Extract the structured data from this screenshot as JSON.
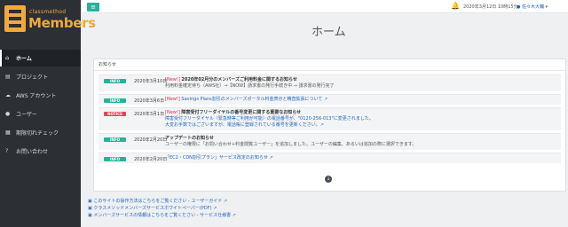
{
  "brand": {
    "small": "classmethod",
    "big": "Members"
  },
  "sidebar": {
    "items": [
      {
        "icon": "home-icon",
        "glyph": "⌂",
        "label": "ホーム"
      },
      {
        "icon": "document-icon",
        "glyph": "▤",
        "label": "プロジェクト"
      },
      {
        "icon": "cloud-icon",
        "glyph": "☁",
        "label": "AWS アカウント"
      },
      {
        "icon": "user-icon",
        "glyph": "●",
        "label": "ユーザー"
      },
      {
        "icon": "calendar-icon",
        "glyph": "▦",
        "label": "期限切れチェック"
      },
      {
        "icon": "question-icon",
        "glyph": "?",
        "label": "お問い合わせ"
      }
    ]
  },
  "topbar": {
    "menu_glyph": "≡",
    "bell_glyph": "🔔",
    "datetime": "2020年3月12日 10時15分",
    "user": "● 佐々木大輔 ▾"
  },
  "page_title": "ホーム",
  "notices": {
    "header": "お知らせ",
    "items": [
      {
        "badge": "INFO",
        "date": "2020年3月10日",
        "new": "[New!]",
        "title": "2020年02月分のメンバーズご利用料金に関するお知らせ",
        "line2": "利用料金確定待ち（AWS社）→【NOW】請求書の発行手続き中 → 請求書の発行完了"
      },
      {
        "badge": "INFO",
        "date": "2020年3月6日",
        "new": "[New!]",
        "title": "Savings Plans割引のメンバーズポータル料金表示と精査拡張について ↗"
      },
      {
        "badge": "NOTICE",
        "date": "2020年3月1日",
        "new": "[New!]",
        "title": "障害受付フリーダイヤルの番号変更に関する重要なお知らせ",
        "line2": "障害受付フリーダイヤル（緊急時等ご利用が可能）の電話番号が、\"0120-256-013\"に変更されました。",
        "line3": "大変お手数ではございますが、電話帳に登録されている番号を更新ください。↗"
      },
      {
        "badge": "INFO",
        "date": "2020年2月20日",
        "title": "アップデートのお知らせ",
        "line2": "ユーザーの権限に「お問い合わせ+料金閲覧ユーザー」を追加しました。ユーザーの編集、あるいは追加の際に選択できます。"
      },
      {
        "badge": "INFO",
        "date": "2020年2月20日",
        "title": "「EC2・CDN割引プラン」サービス改定のお知らせ ↗"
      }
    ],
    "more_glyph": "↓"
  },
  "footer": {
    "links": [
      "このサイトの操作方法はこちらをご覧ください - ユーザーガイド ↗",
      "クラスメソッドメンバーズサービスホワイトペーパー(PDF) ↗",
      "メンバーズサービスの情報はこちらをご覧ください - サービス仕様書 ↗"
    ]
  },
  "colors": {
    "sidebar": "#2c3035",
    "accent": "#27b39a",
    "notice": "#e0455a",
    "brand": "#f1a93d",
    "link": "#1f64c0"
  }
}
